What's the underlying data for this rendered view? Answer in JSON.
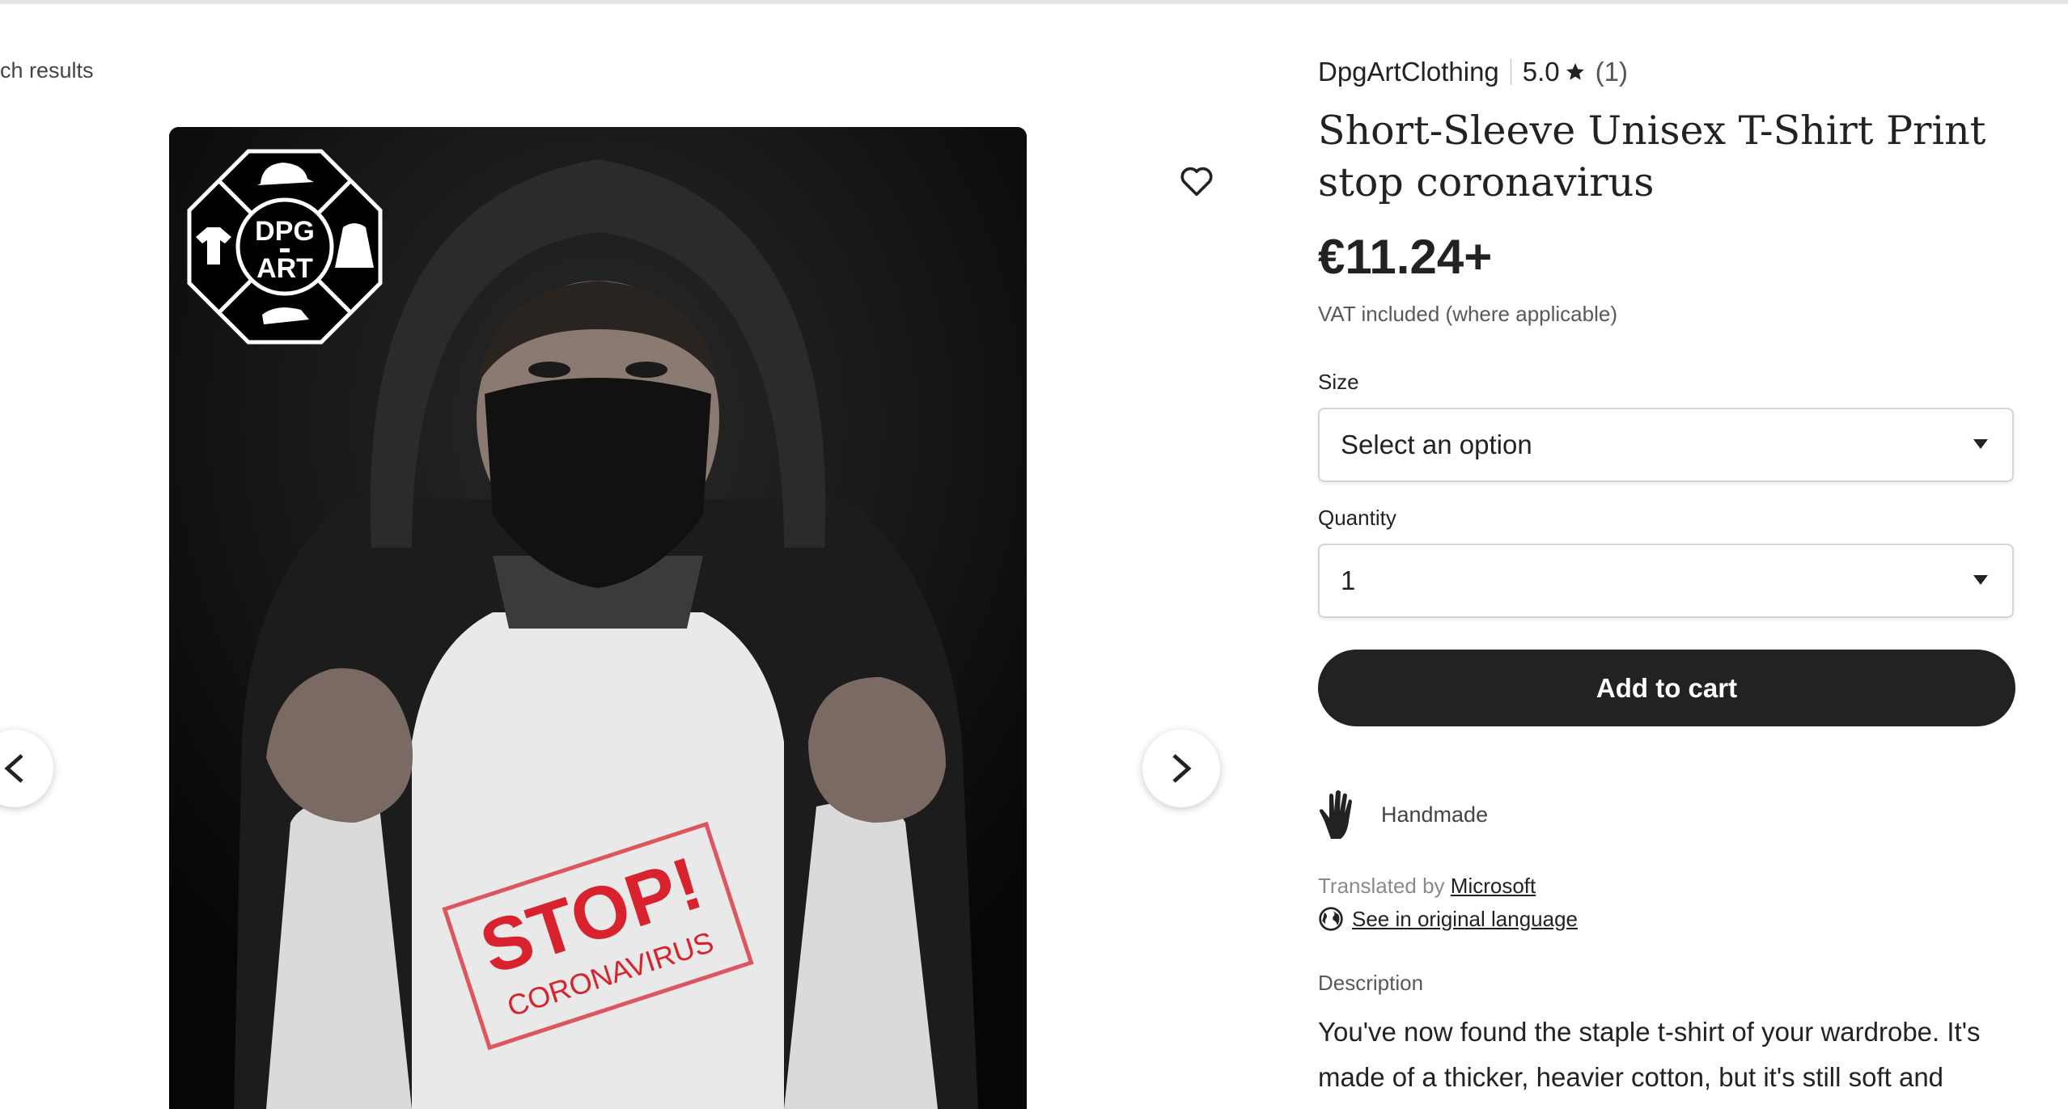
{
  "nav": {
    "back_label": "ch results"
  },
  "gallery": {
    "logo_text_top": "DPG",
    "logo_text_bottom": "ART",
    "print_text_stop": "STOP!",
    "print_text_sub": "CORONAVIRUS"
  },
  "listing": {
    "shop_name": "DpgArtClothing",
    "rating": "5.0",
    "review_count": "(1)",
    "title": "Short-Sleeve Unisex T-Shirt Print stop coronavirus",
    "price": "€11.24+",
    "vat_note": "VAT included (where applicable)"
  },
  "size": {
    "label": "Size",
    "value": "Select an option"
  },
  "quantity": {
    "label": "Quantity",
    "value": "1"
  },
  "cart": {
    "button_label": "Add to cart"
  },
  "features": {
    "handmade_label": "Handmade"
  },
  "translation": {
    "prefix": "Translated by",
    "provider": "Microsoft",
    "original_link": "See in original language"
  },
  "description": {
    "label": "Description",
    "text": "You've now found the staple t-shirt of your wardrobe. It's made of a thicker, heavier cotton, but it's still soft and"
  },
  "colors": {
    "primary": "#222222",
    "muted": "#595959",
    "stamp_red": "#d8232f"
  },
  "icons": [
    "heart-icon",
    "chevron-left-icon",
    "chevron-right-icon",
    "star-icon",
    "hand-icon",
    "globe-icon",
    "caret-down-icon"
  ]
}
